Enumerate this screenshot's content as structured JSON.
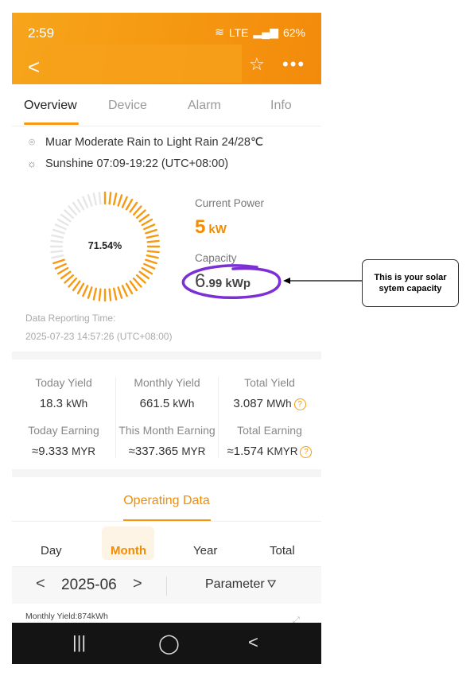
{
  "status_bar": {
    "time": "2:59",
    "battery": "62%",
    "network": "LTE"
  },
  "nav": {
    "back": "<",
    "star": "☆",
    "more": "•••"
  },
  "tabs": [
    {
      "label": "Overview",
      "active": true
    },
    {
      "label": "Device",
      "active": false
    },
    {
      "label": "Alarm",
      "active": false
    },
    {
      "label": "Info",
      "active": false
    }
  ],
  "weather": {
    "text": "Muar Moderate Rain to Light Rain 24/28℃"
  },
  "sunshine": {
    "text": "Sunshine 07:09-19:22 (UTC+08:00)"
  },
  "gauge": {
    "percent_label": "71.54%",
    "percent": 71.54
  },
  "current_power": {
    "label": "Current Power",
    "value": "5",
    "unit": "kW"
  },
  "capacity": {
    "label": "Capacity",
    "int": "6",
    "dec": ".99 kWp"
  },
  "report": {
    "label": "Data Reporting Time:",
    "time": "2025-07-23 14:57:26 (UTC+08:00)"
  },
  "yields": [
    {
      "label": "Today Yield",
      "value": "18.3",
      "unit": "kWh",
      "help": false
    },
    {
      "label": "Monthly Yield",
      "value": "661.5",
      "unit": "kWh",
      "help": false
    },
    {
      "label": "Total Yield",
      "value": "3.087",
      "unit": "MWh",
      "help": true
    },
    {
      "label": "Today Earning",
      "value": "≈9.333",
      "unit": "MYR",
      "help": false
    },
    {
      "label": "This Month Earning",
      "value": "≈337.365",
      "unit": "MYR",
      "help": false
    },
    {
      "label": "Total Earning",
      "value": "≈1.574",
      "unit": "KMYR",
      "help": true
    }
  ],
  "operating": {
    "title": "Operating Data"
  },
  "periods": [
    {
      "label": "Day",
      "active": false
    },
    {
      "label": "Month",
      "active": true
    },
    {
      "label": "Year",
      "active": false
    },
    {
      "label": "Total",
      "active": false
    }
  ],
  "date_nav": {
    "value": "2025-06",
    "prev": "<",
    "next": ">",
    "parameter": "Parameter"
  },
  "chart_caption": "Monthly Yield:874kWh",
  "callout": {
    "text": "This is your solar sytem capacity"
  },
  "colors": {
    "accent": "#f59a12",
    "header": "#f7a51c",
    "annotation": "#7b2fd4"
  }
}
